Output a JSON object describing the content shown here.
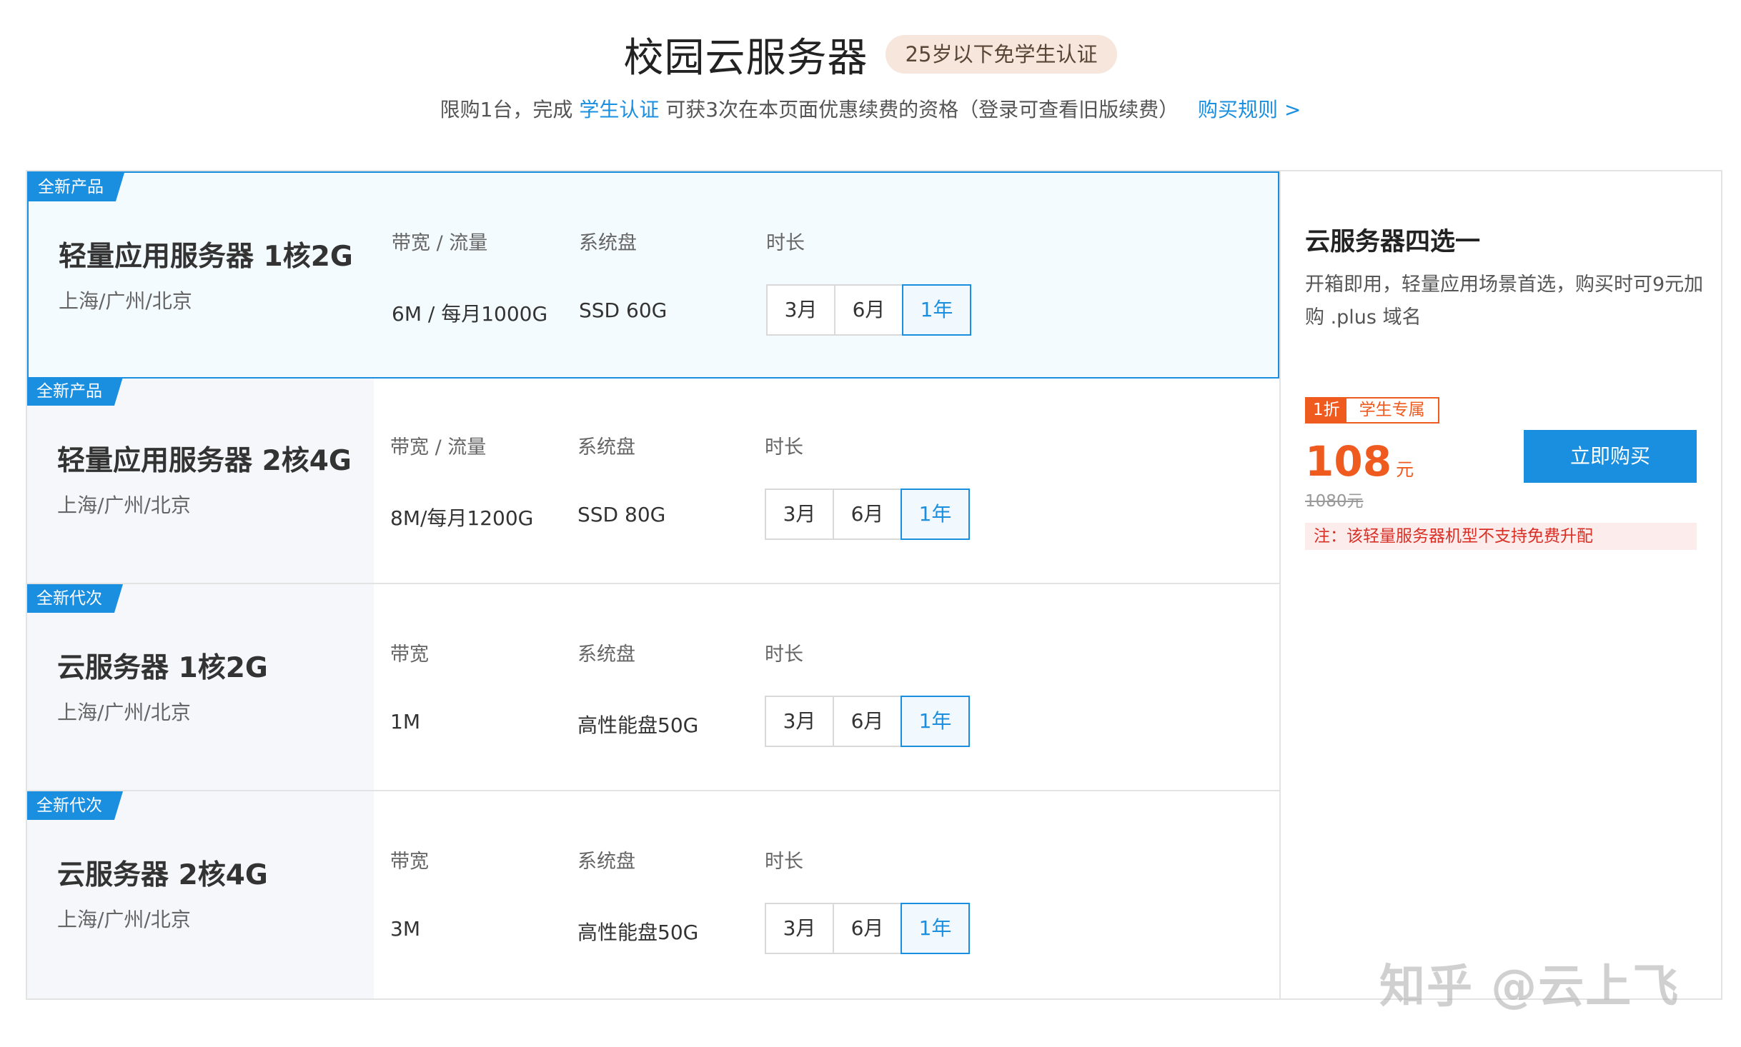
{
  "header": {
    "title": "校园云服务器",
    "badge": "25岁以下免学生认证"
  },
  "subtitle": {
    "prefix": "限购1台，完成",
    "link": "学生认证",
    "suffix": "可获3次在本页面优惠续费的资格（登录可查看旧版续费）",
    "rules": "购买规则 >"
  },
  "products": [
    {
      "ribbon": "全新产品",
      "name": "轻量应用服务器 1核2G",
      "region": "上海/广州/北京",
      "bw_label": "带宽 / 流量",
      "bw_value": "6M / 每月1000G",
      "disk_label": "系统盘",
      "disk_value": "SSD 60G",
      "dur_label": "时长",
      "durations": [
        "3月",
        "6月",
        "1年"
      ],
      "selected_duration": "1年",
      "selected": true
    },
    {
      "ribbon": "全新产品",
      "name": "轻量应用服务器 2核4G",
      "region": "上海/广州/北京",
      "bw_label": "带宽 / 流量",
      "bw_value": "8M/每月1200G",
      "disk_label": "系统盘",
      "disk_value": "SSD 80G",
      "dur_label": "时长",
      "durations": [
        "3月",
        "6月",
        "1年"
      ],
      "selected_duration": "1年",
      "selected": false
    },
    {
      "ribbon": "全新代次",
      "name": "云服务器 1核2G",
      "region": "上海/广州/北京",
      "bw_label": "带宽",
      "bw_value": "1M",
      "disk_label": "系统盘",
      "disk_value": "高性能盘50G",
      "dur_label": "时长",
      "durations": [
        "3月",
        "6月",
        "1年"
      ],
      "selected_duration": "1年",
      "selected": false
    },
    {
      "ribbon": "全新代次",
      "name": "云服务器 2核4G",
      "region": "上海/广州/北京",
      "bw_label": "带宽",
      "bw_value": "3M",
      "disk_label": "系统盘",
      "disk_value": "高性能盘50G",
      "dur_label": "时长",
      "durations": [
        "3月",
        "6月",
        "1年"
      ],
      "selected_duration": "1年",
      "selected": false
    }
  ],
  "detail": {
    "title": "云服务器四选一",
    "description": "开箱即用，轻量应用场景首选，购买时可9元加购 .plus 域名",
    "tag_discount": "1折",
    "tag_student": "学生专属",
    "price": "108",
    "price_unit": "元",
    "original_price": "1080元",
    "buy_label": "立即购买",
    "notice": "注：该轻量服务器机型不支持免费升配"
  },
  "watermark": "知乎 @云上飞",
  "colors": {
    "accent": "#1a8fe0",
    "price": "#ef5a1e",
    "notice_bg": "#fdecec",
    "notice_text": "#d93026",
    "badge_bg": "#f7e6dc"
  }
}
